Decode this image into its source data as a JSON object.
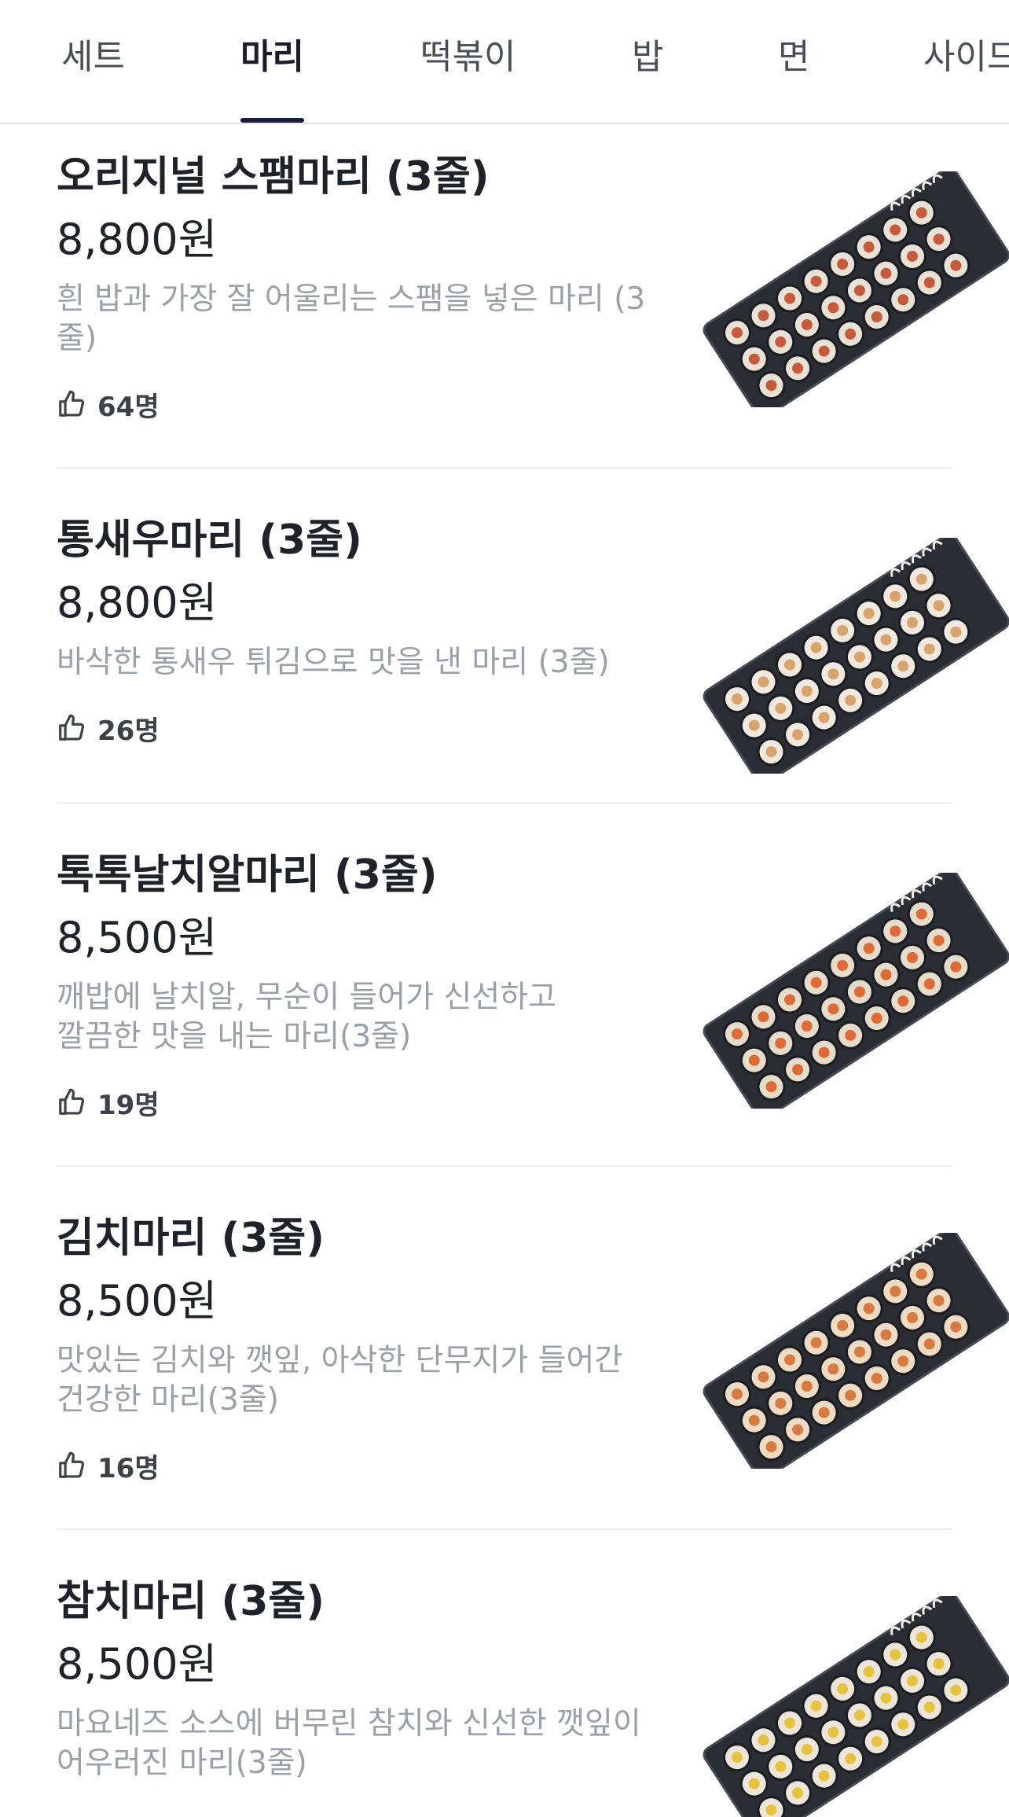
{
  "tabs": [
    {
      "label": "세트",
      "active": false
    },
    {
      "label": "마리",
      "active": true
    },
    {
      "label": "떡볶이",
      "active": false
    },
    {
      "label": "밥",
      "active": false
    },
    {
      "label": "면",
      "active": false
    },
    {
      "label": "사이드",
      "active": false
    }
  ],
  "menu": [
    {
      "name": "오리지널 스팸마리 (3줄)",
      "price": "8,800원",
      "desc": "흰 밥과 가장 잘 어울리는 스팸을 넣은 마리 (3줄)",
      "likes": "64명",
      "filling": [
        "#c85a3a",
        "#e8e2d6"
      ]
    },
    {
      "name": "통새우마리 (3줄)",
      "price": "8,800원",
      "desc": "바삭한 통새우 튀김으로 맛을 낸 마리 (3줄)",
      "likes": "26명",
      "filling": [
        "#d9a36a",
        "#efe9df"
      ]
    },
    {
      "name": "톡톡날치알마리 (3줄)",
      "price": "8,500원",
      "desc": "깨밥에 날치알, 무순이 들어가 신선하고 깔끔한 맛을 내는 마리(3줄)",
      "likes": "19명",
      "filling": [
        "#e06a34",
        "#e6dccb"
      ]
    },
    {
      "name": "김치마리 (3줄)",
      "price": "8,500원",
      "desc": "맛있는 김치와 깻잎, 아삭한 단무지가 들어간 건강한 마리(3줄)",
      "likes": "16명",
      "filling": [
        "#d8793e",
        "#eddcc3"
      ]
    },
    {
      "name": "참치마리 (3줄)",
      "price": "8,500원",
      "desc": "마요네즈 소스에 버무린 참치와 신선한 깻잎이 어우러진 마리(3줄)",
      "likes": "",
      "filling": [
        "#e7c23a",
        "#ece6da"
      ]
    }
  ],
  "icons": {
    "like": "thumbs-up-icon"
  }
}
